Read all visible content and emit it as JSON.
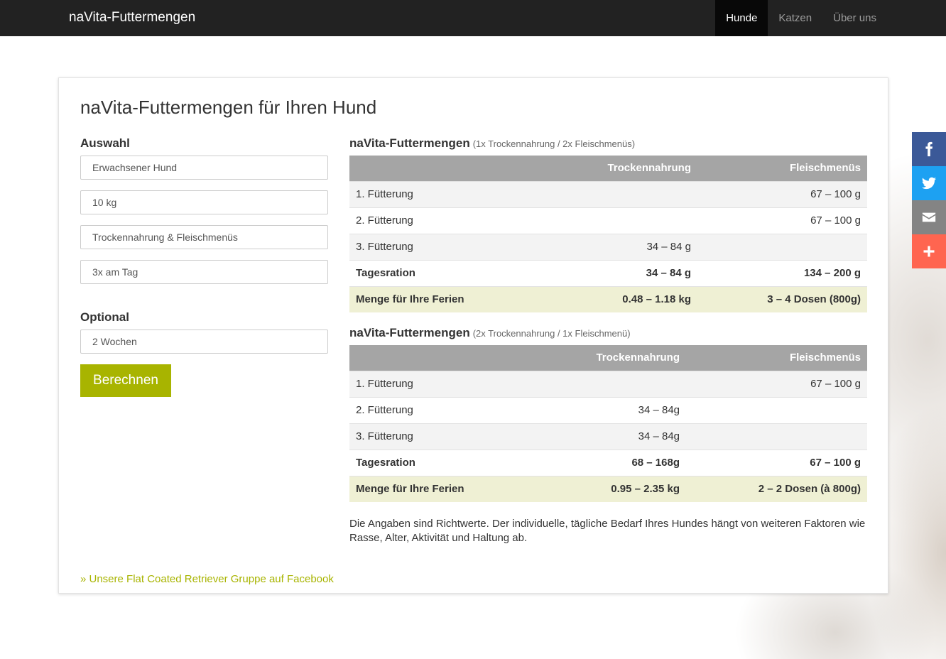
{
  "navbar": {
    "brand": "naVita-Futtermengen",
    "items": [
      {
        "label": "Hunde",
        "active": true
      },
      {
        "label": "Katzen",
        "active": false
      },
      {
        "label": "Über uns",
        "active": false
      }
    ]
  },
  "card": {
    "title": "naVita-Futtermengen für Ihren Hund",
    "auswahl_label": "Auswahl",
    "selects": {
      "age": "Erwachsener Hund",
      "weight": "10 kg",
      "food": "Trockennahrung & Fleischmenüs",
      "frequency": "3x am Tag"
    },
    "optional_label": "Optional",
    "duration": "2 Wochen",
    "calc_button": "Berechnen",
    "table1": {
      "title": "naVita-Futtermengen",
      "subtitle": "(1x Trockennahrung / 2x Fleischmenüs)",
      "headers": [
        "",
        "Trockennahrung",
        "Fleischmenüs"
      ],
      "rows": [
        [
          "1. Fütterung",
          "",
          "67 – 100 g"
        ],
        [
          "2. Fütterung",
          "",
          "67 – 100 g"
        ],
        [
          "3. Fütterung",
          "34 – 84 g",
          ""
        ],
        [
          "Tagesration",
          "34 – 84 g",
          "134 – 200 g"
        ],
        [
          "Menge für Ihre Ferien",
          "0.48 – 1.18 kg",
          "3 – 4 Dosen (800g)"
        ]
      ]
    },
    "table2": {
      "title": "naVita-Futtermengen",
      "subtitle": "(2x Trockennahrung / 1x Fleischmenü)",
      "headers": [
        "",
        "Trockennahrung",
        "Fleischmenüs"
      ],
      "rows": [
        [
          "1. Fütterung",
          "",
          "67 – 100 g"
        ],
        [
          "2. Fütterung",
          "34 – 84g",
          ""
        ],
        [
          "3. Fütterung",
          "34 – 84g",
          ""
        ],
        [
          "Tagesration",
          "68 – 168g",
          "67 – 100 g"
        ],
        [
          "Menge für Ihre Ferien",
          "0.95 – 2.35 kg",
          "2 – 2 Dosen (à 800g)"
        ]
      ]
    },
    "note": "Die Angaben sind Richtwerte. Der individuelle, tägliche Bedarf Ihres Hundes hängt von weiteren Faktoren wie Rasse, Alter, Aktivität und Haltung ab.",
    "facebook_link": "» Unsere Flat Coated Retriever Gruppe auf Facebook"
  },
  "social": [
    "facebook-icon",
    "twitter-icon",
    "mail-icon",
    "plus-icon"
  ],
  "colors": {
    "accent": "#a8b400",
    "navbar": "#222222",
    "table_header": "#a5a5a5",
    "ferien_row": "#eff0d4"
  }
}
